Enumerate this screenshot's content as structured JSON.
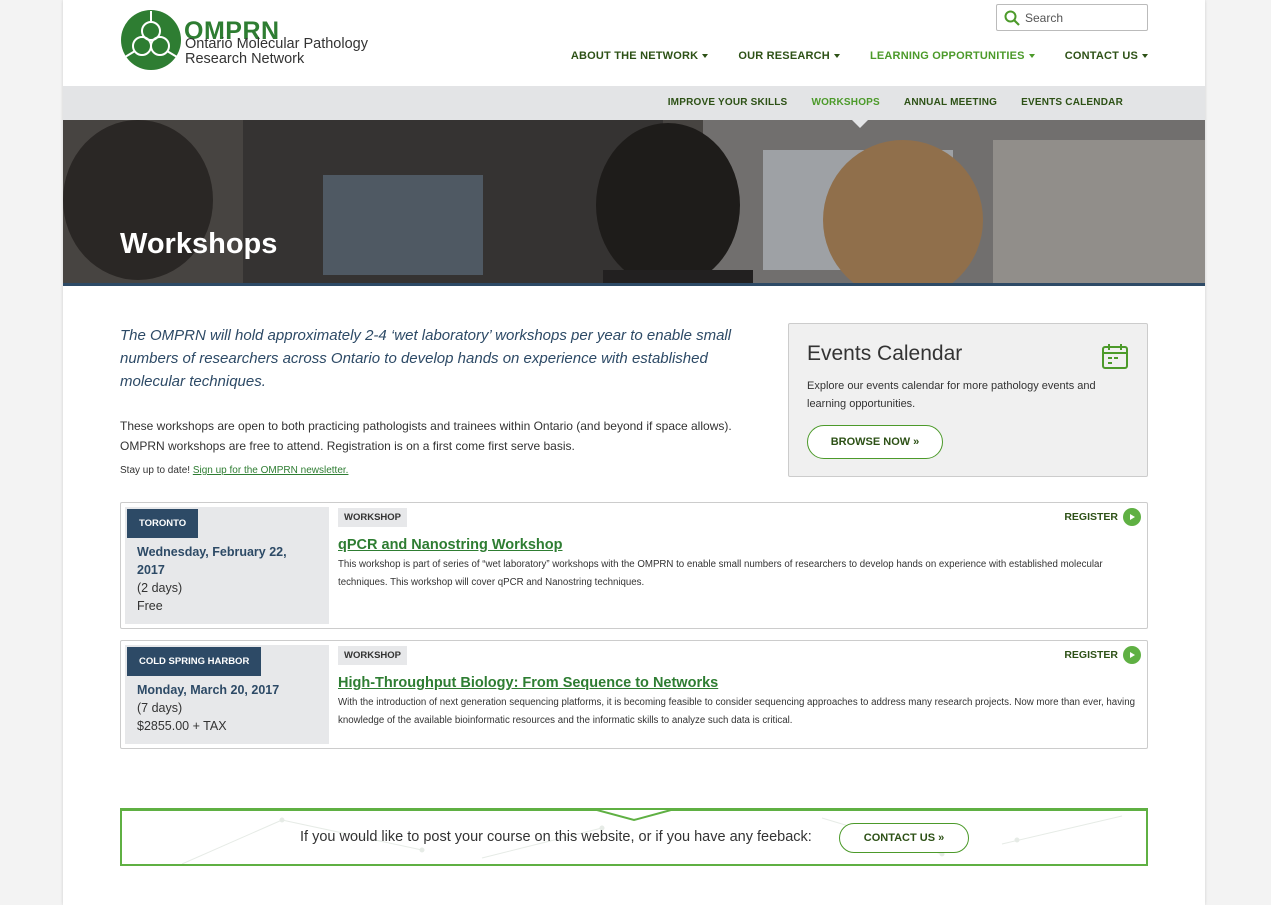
{
  "brand": {
    "acronym": "OMPRN",
    "name": "Ontario Molecular Pathology Research Network",
    "color_primary": "#2e7d32",
    "color_navy": "#2d4a66"
  },
  "search": {
    "placeholder": "Search",
    "icon": "search-icon"
  },
  "main_nav": [
    {
      "label": "ABOUT THE NETWORK",
      "active": false
    },
    {
      "label": "OUR RESEARCH",
      "active": false
    },
    {
      "label": "LEARNING OPPORTUNITIES",
      "active": true
    },
    {
      "label": "CONTACT US",
      "active": false
    }
  ],
  "sub_nav": [
    {
      "label": "IMPROVE YOUR SKILLS",
      "active": false
    },
    {
      "label": "WORKSHOPS",
      "active": true
    },
    {
      "label": "ANNUAL MEETING",
      "active": false
    },
    {
      "label": "EVENTS CALENDAR",
      "active": false
    }
  ],
  "hero": {
    "title": "Workshops"
  },
  "intro": {
    "lead": "The OMPRN will hold approximately 2-4 ‘wet laboratory’ workshops per year to enable small numbers of researchers across Ontario to develop hands on experience with established molecular techniques.",
    "body_line1": "These workshops are open to both practicing pathologists and trainees within Ontario (and beyond if space allows).",
    "body_line2": "OMPRN workshops are free to attend. Registration is on a first come first serve basis.",
    "stay_prefix": "Stay up to date! ",
    "stay_link": "Sign up for the OMPRN newsletter."
  },
  "events_calendar": {
    "title": "Events Calendar",
    "description": "Explore our events calendar for more pathology events and learning opportunities.",
    "button": "BROWSE NOW »",
    "icon": "calendar-icon"
  },
  "workshops": [
    {
      "city": "TORONTO",
      "date_line1": "Wednesday, February 22,",
      "date_line2": "2017",
      "duration": "(2 days)",
      "price": "Free",
      "type": "WORKSHOP",
      "title": "qPCR and Nanostring Workshop",
      "description": "This workshop is part of series of “wet laboratory” workshops with the OMPRN to enable small numbers of researchers to develop hands on experience with established molecular techniques. This workshop will cover qPCR and Nanostring techniques.",
      "register": "REGISTER"
    },
    {
      "city": "COLD SPRING HARBOR",
      "date_line1": "Monday, March 20, 2017",
      "duration": "(7 days)",
      "price": "$2855.00 + TAX",
      "type": "WORKSHOP",
      "title": "High-Throughput Biology: From Sequence to Networks",
      "description": "With the introduction of next generation sequencing platforms, it is becoming feasible to consider sequencing approaches to address many research projects. Now more than ever, having knowledge of the available bioinformatic resources and the informatic skills to analyze such data is critical.",
      "register": "REGISTER"
    }
  ],
  "cta": {
    "text": "If you would like to post your course on this website, or if you have any feeback:",
    "button": "CONTACT US »"
  }
}
